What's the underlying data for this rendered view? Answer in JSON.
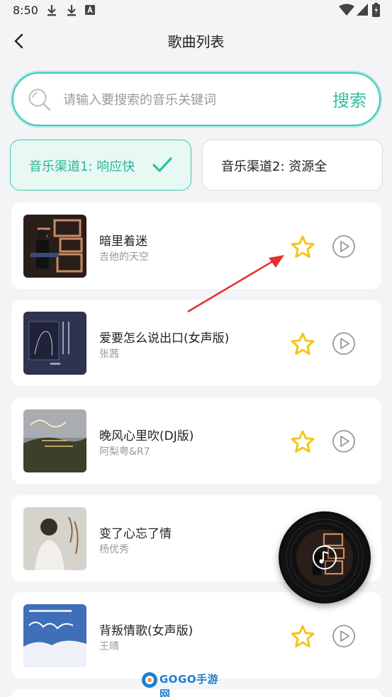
{
  "status_bar": {
    "time": "8:50",
    "left_icons": [
      "download-icon",
      "download-icon",
      "keyboard-a-icon"
    ],
    "right_icons": [
      "wifi-icon",
      "signal-icon",
      "battery-icon"
    ]
  },
  "header": {
    "title": "歌曲列表",
    "back_icon": "chevron-left-icon"
  },
  "search": {
    "placeholder": "请输入要搜索的音乐关键词",
    "value": "",
    "button_label": "搜索"
  },
  "channels": [
    {
      "label": "音乐渠道1: 响应快",
      "selected": true
    },
    {
      "label": "音乐渠道2: 资源全",
      "selected": false
    }
  ],
  "songs": [
    {
      "title": "暗里着迷",
      "artist": "吉他的天空"
    },
    {
      "title": "爱要怎么说出口(女声版)",
      "artist": "张茜"
    },
    {
      "title": "晚风心里吹(DJ版)",
      "artist": "阿梨粤&R7"
    },
    {
      "title": "变了心忘了情",
      "artist": "杨优秀"
    },
    {
      "title": "背叛情歌(女声版)",
      "artist": "王晴"
    }
  ],
  "colors": {
    "accent": "#33bfa3",
    "star": "#f5c518",
    "background": "#f3f4f6",
    "annotation_arrow": "#e53030"
  },
  "watermark": {
    "text": "GOGO手游网"
  }
}
